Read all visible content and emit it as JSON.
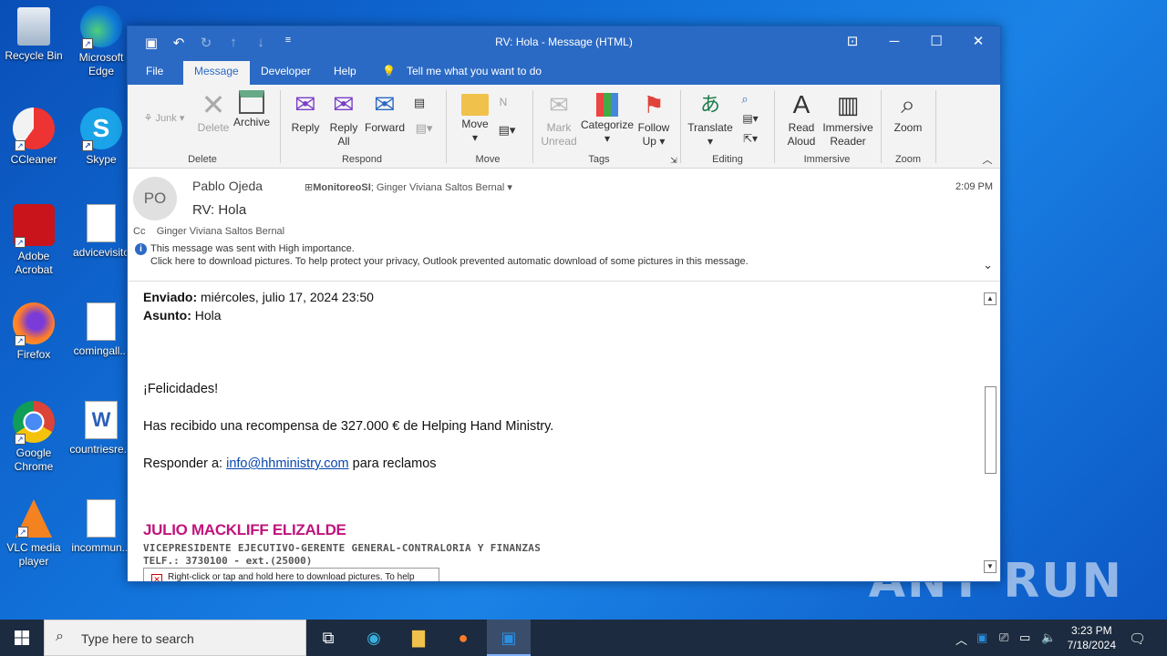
{
  "desktop": {
    "icons": [
      {
        "label": "Recycle Bin",
        "icon": "recycle-bin-icon"
      },
      {
        "label": "Microsoft Edge",
        "icon": "edge-icon"
      },
      {
        "label": "CCleaner",
        "icon": "ccleaner-icon"
      },
      {
        "label": "Skype",
        "icon": "skype-icon"
      },
      {
        "label": "Adobe Acrobat",
        "icon": "acrobat-icon"
      },
      {
        "label": "advicevisito",
        "icon": "image-file-icon"
      },
      {
        "label": "Firefox",
        "icon": "firefox-icon"
      },
      {
        "label": "comingall...",
        "icon": "image-file-icon"
      },
      {
        "label": "Google Chrome",
        "icon": "chrome-icon"
      },
      {
        "label": "countriesre...",
        "icon": "word-file-icon"
      },
      {
        "label": "VLC media player",
        "icon": "vlc-icon"
      },
      {
        "label": "incommun...",
        "icon": "image-file-icon"
      }
    ],
    "watermark": "ANY RUN"
  },
  "window": {
    "title": "RV: Hola  -  Message (HTML)",
    "menus": [
      "File",
      "Message",
      "Developer",
      "Help"
    ],
    "tell_me": "Tell me what you want to do",
    "active_menu": "Message"
  },
  "ribbon": {
    "delete": {
      "junk": "Junk",
      "delete": "Delete",
      "archive": "Archive",
      "group": "Delete"
    },
    "respond": {
      "reply": "Reply",
      "reply_all_1": "Reply",
      "reply_all_2": "All",
      "forward": "Forward",
      "group": "Respond"
    },
    "move": {
      "move": "Move",
      "group": "Move"
    },
    "tags": {
      "mark_1": "Mark",
      "mark_2": "Unread",
      "categorize": "Categorize",
      "follow_1": "Follow",
      "follow_2": "Up",
      "group": "Tags"
    },
    "editing": {
      "translate": "Translate",
      "group": "Editing"
    },
    "immersive": {
      "read_1": "Read",
      "read_2": "Aloud",
      "immersive_1": "Immersive",
      "immersive_2": "Reader",
      "group": "Immersive"
    },
    "zoom": {
      "zoom": "Zoom",
      "group": "Zoom"
    }
  },
  "header": {
    "avatar": "PO",
    "sender": "Pablo Ojeda",
    "to_bold": "MonitoreoSI",
    "to_rest": "; Ginger Viviana Saltos Bernal",
    "time": "2:09 PM",
    "subject": "RV: Hola",
    "cc_label": "Cc",
    "cc": "Ginger Viviana Saltos Bernal",
    "info1": "This message was sent with High importance.",
    "info2": "Click here to download pictures. To help protect your privacy, Outlook prevented automatic download of some pictures in this message."
  },
  "body": {
    "sent_label": "Enviado:",
    "sent_value": "miércoles, julio 17, 2024 23:50",
    "subject_label": "Asunto:",
    "subject_value": "Hola",
    "greeting": "¡Felicidades!",
    "line1": "Has recibido una recompensa de 327.000 € de Helping Hand Ministry.",
    "line2_pre": "Responder a:",
    "line2_link": "info@hhministry.com",
    "line2_post": "para reclamos",
    "sig_name": "JULIO MACKLIFF ELIZALDE",
    "sig_title": "VICEPRESIDENTE EJECUTIVO-GERENTE GENERAL-CONTRALORIA Y FINANZAS",
    "sig_tel": "TELF.: 3730100 - ext.(25000)",
    "img_placeholder": "Right-click or tap and hold here to download pictures. To help protect your privacy, Outlook prevented automatic download of this picture from the Internet."
  },
  "taskbar": {
    "search_placeholder": "Type here to search",
    "time": "3:23 PM",
    "date": "7/18/2024"
  }
}
